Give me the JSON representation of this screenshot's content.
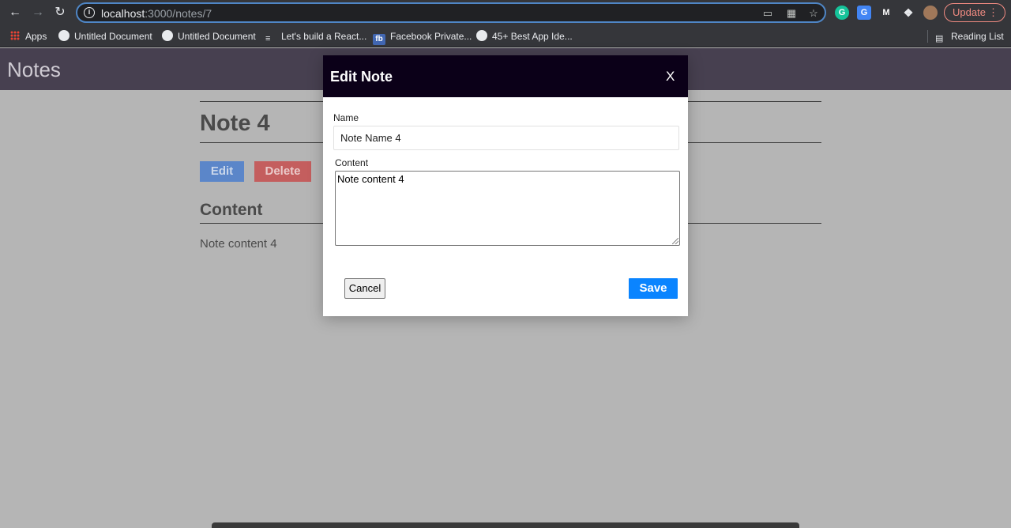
{
  "browser": {
    "url_host": "localhost",
    "url_path": ":3000/notes/7",
    "update_label": "Update",
    "bookmarks": [
      {
        "label": "Apps",
        "icon": "apps-grid-icon"
      },
      {
        "label": "Untitled Document",
        "icon": "globe-icon"
      },
      {
        "label": "Untitled Document",
        "icon": "globe-icon"
      },
      {
        "label": "Let's build a React...",
        "icon": "list-icon"
      },
      {
        "label": "Facebook Private...",
        "icon": "fb-icon"
      },
      {
        "label": "45+ Best App Ide...",
        "icon": "globe-icon"
      }
    ],
    "reading_list": "Reading List"
  },
  "app": {
    "title": "Notes"
  },
  "note": {
    "title": "Note 4",
    "edit_label": "Edit",
    "delete_label": "Delete",
    "content_heading": "Content",
    "content_text": "Note content 4"
  },
  "modal": {
    "title": "Edit Note",
    "close_label": "X",
    "name_label": "Name",
    "name_value": "Note Name 4",
    "content_label": "Content",
    "content_value": "Note content 4",
    "cancel_label": "Cancel",
    "save_label": "Save"
  },
  "colors": {
    "modal_header": "#0b0018",
    "save_button": "#0a84ff",
    "edit_button": "#5b86c9",
    "delete_button": "#c45e5e",
    "app_header": "#474050"
  }
}
